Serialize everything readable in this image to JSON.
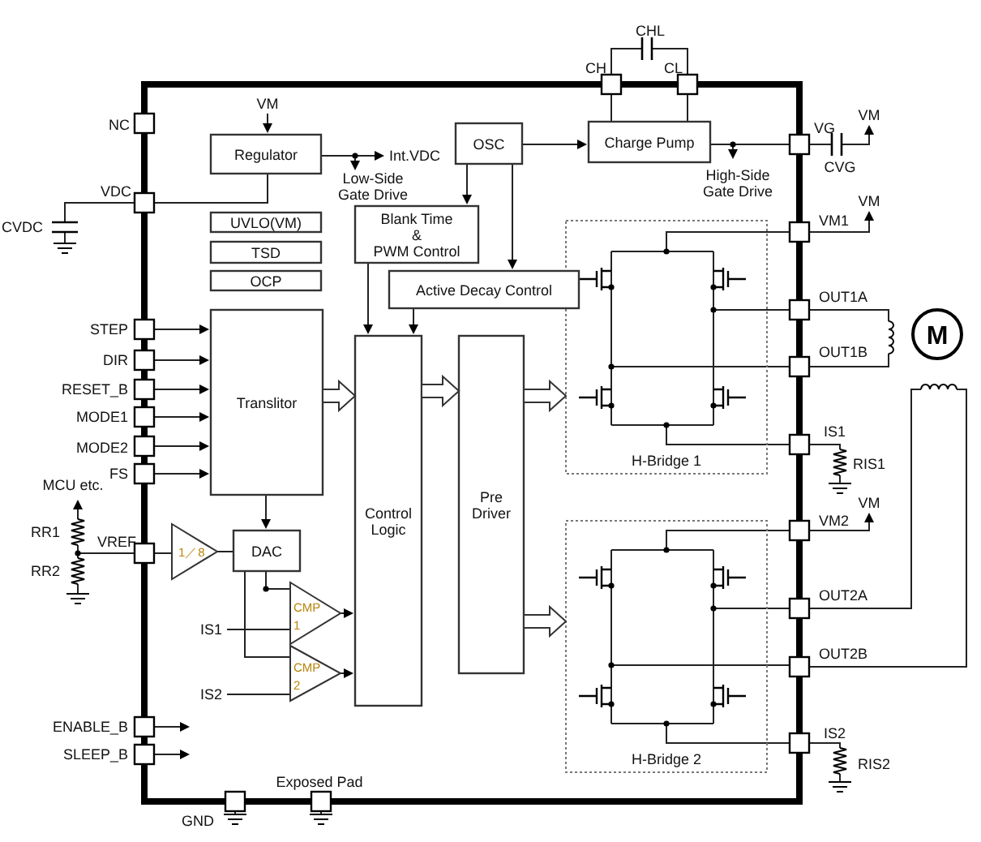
{
  "chip": {
    "blocks": [
      {
        "lines": [
          "Regulator"
        ]
      },
      {
        "lines": [
          "UVLO(VM)"
        ]
      },
      {
        "lines": [
          "TSD"
        ]
      },
      {
        "lines": [
          "OCP"
        ]
      },
      {
        "lines": [
          "OSC"
        ]
      },
      {
        "lines": [
          "Charge Pump"
        ]
      },
      {
        "lines": [
          "Blank Time",
          "&",
          "PWM Control"
        ]
      },
      {
        "lines": [
          "Active Decay Control"
        ]
      },
      {
        "lines": [
          "Translitor"
        ]
      },
      {
        "lines": [
          "DAC"
        ]
      },
      {
        "lines": [
          "Control",
          "Logic"
        ]
      },
      {
        "lines": [
          "Pre",
          "Driver"
        ]
      }
    ],
    "amplifiers": [
      {
        "lines": [
          "1／8"
        ]
      },
      {
        "lines": [
          "CMP",
          "1"
        ]
      },
      {
        "lines": [
          "CMP",
          "2"
        ]
      }
    ],
    "bridges": [
      {
        "label": "H-Bridge 1"
      },
      {
        "label": "H-Bridge 2"
      }
    ]
  },
  "pins": [
    "NC",
    "VDC",
    "STEP",
    "DIR",
    "RESET_B",
    "MODE1",
    "MODE2",
    "FS",
    "VREF",
    "ENABLE_B",
    "SLEEP_B",
    "CH",
    "CL",
    "VG",
    "VM1",
    "OUT1A",
    "OUT1B",
    "IS1",
    "VM2",
    "OUT2A",
    "OUT2B",
    "IS2",
    "GND",
    "Exposed Pad"
  ],
  "signals": [
    {
      "lines": [
        "Int.VDC"
      ]
    },
    {
      "lines": [
        "Low-Side",
        "Gate Drive"
      ]
    },
    {
      "lines": [
        "High-Side",
        "Gate Drive"
      ]
    },
    {
      "lines": [
        "IS1"
      ]
    },
    {
      "lines": [
        "IS2"
      ]
    }
  ],
  "external": {
    "supplies": [
      "VM",
      "VM",
      "VM",
      "VM"
    ],
    "components": [
      {
        "kind": "capacitor",
        "label": "CVDC"
      },
      {
        "kind": "capacitor",
        "label": "CHL"
      },
      {
        "kind": "capacitor",
        "label": "CVG"
      },
      {
        "kind": "resistor",
        "label": "RR1"
      },
      {
        "kind": "resistor",
        "label": "RR2"
      },
      {
        "kind": "resistor",
        "label": "RIS1"
      },
      {
        "kind": "resistor",
        "label": "RIS2"
      }
    ],
    "source": "MCU etc.",
    "motor": "M"
  }
}
